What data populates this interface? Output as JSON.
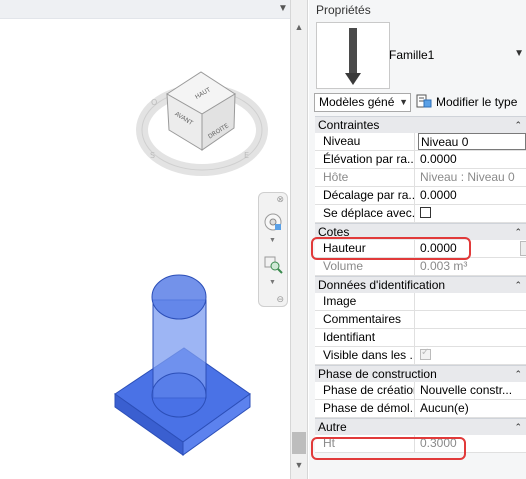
{
  "viewcube": {
    "top_label": "HAUT",
    "front_label": "AVANT",
    "right_label": "DROITE"
  },
  "properties": {
    "title": "Propriétés",
    "family_name": "Famille1",
    "type_selector": "Modèles géné",
    "edit_type_label": "Modifier le type",
    "groups": [
      {
        "name": "Contraintes",
        "rows": [
          {
            "label": "Niveau",
            "value": "Niveau 0"
          },
          {
            "label": "Élévation par ra...",
            "value": "0.0000"
          },
          {
            "label": "Hôte",
            "value": "Niveau : Niveau 0"
          },
          {
            "label": "Décalage par ra...",
            "value": "0.0000"
          },
          {
            "label": "Se déplace avec...",
            "value": ""
          }
        ]
      },
      {
        "name": "Cotes",
        "rows": [
          {
            "label": "Hauteur",
            "value": "0.0000"
          },
          {
            "label": "Volume",
            "value": "0.003 m³"
          }
        ]
      },
      {
        "name": "Données d'identification",
        "rows": [
          {
            "label": "Image",
            "value": ""
          },
          {
            "label": "Commentaires",
            "value": ""
          },
          {
            "label": "Identifiant",
            "value": ""
          },
          {
            "label": "Visible dans les ...",
            "value": ""
          }
        ]
      },
      {
        "name": "Phase de construction",
        "rows": [
          {
            "label": "Phase de création",
            "value": "Nouvelle constr..."
          },
          {
            "label": "Phase de démol...",
            "value": "Aucun(e)"
          }
        ]
      },
      {
        "name": "Autre",
        "rows": [
          {
            "label": "Ht",
            "value": "0.3000"
          }
        ]
      }
    ]
  },
  "colors": {
    "highlight": "#e13a3a",
    "model_fill": "#4a72e6",
    "group_bg": "#e8e9ec"
  },
  "icons": [
    "viewcube",
    "steering-wheel-icon",
    "zoom-icon",
    "edit-type-icon",
    "collapse-chevron-icon",
    "dropdown-arrow-icon"
  ]
}
